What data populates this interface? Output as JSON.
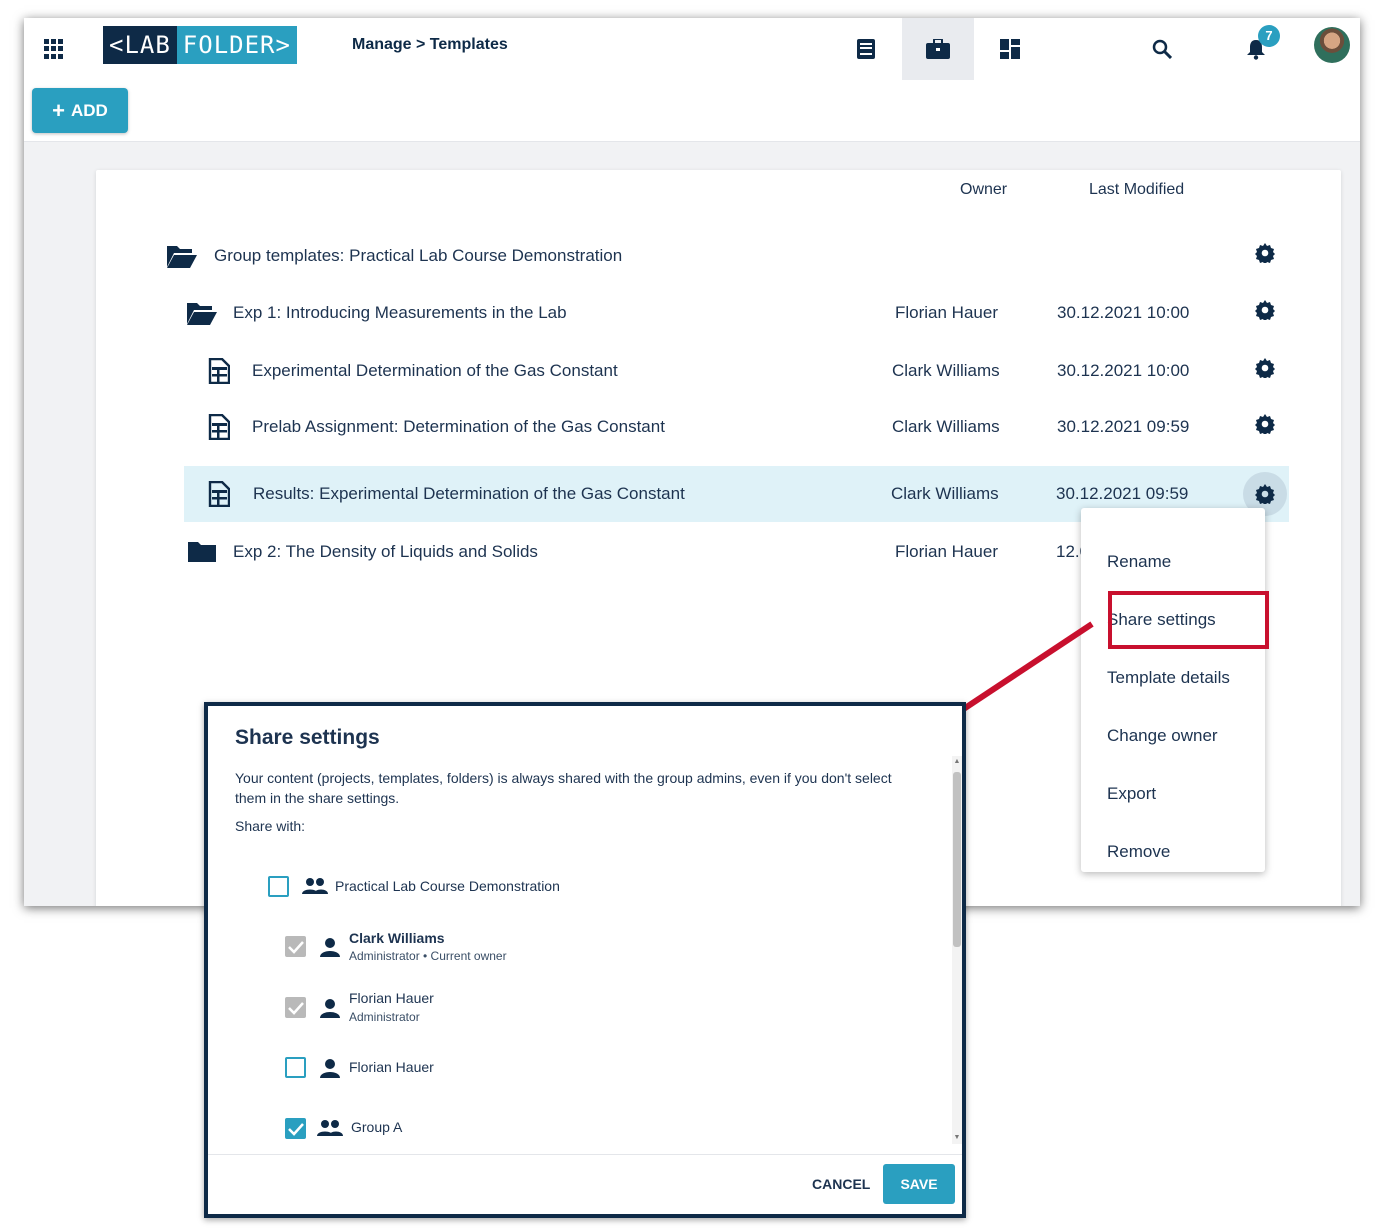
{
  "colors": {
    "navy": "#0e2a47",
    "accent": "#2a9fc0",
    "selected_row": "#dff2f8",
    "highlight": "#c8102e"
  },
  "header": {
    "logo_left": "<LAB",
    "logo_right": "FOLDER>",
    "breadcrumb": "Manage > Templates",
    "notification_count": "7",
    "icons": [
      "apps-grid-icon",
      "notebook-icon",
      "briefcase-icon",
      "dashboard-icon",
      "search-icon",
      "bell-icon"
    ]
  },
  "toolbar": {
    "add_label": "ADD"
  },
  "table": {
    "owner_header": "Owner",
    "modified_header": "Last Modified",
    "rows": [
      {
        "name": "Group templates: Practical Lab Course Demonstration",
        "owner": "",
        "modified": "",
        "icon": "folder-open-icon"
      },
      {
        "name": "Exp 1: Introducing Measurements in the Lab",
        "owner": "Florian Hauer",
        "modified": "30.12.2021 10:00",
        "icon": "folder-open-icon"
      },
      {
        "name": "Experimental Determination of the Gas Constant",
        "owner": "Clark Williams",
        "modified": "30.12.2021 10:00",
        "icon": "template-icon"
      },
      {
        "name": "Prelab Assignment: Determination of the Gas Constant",
        "owner": "Clark Williams",
        "modified": "30.12.2021 09:59",
        "icon": "template-icon"
      },
      {
        "name": "Results: Experimental Determination of the Gas Constant",
        "owner": "Clark Williams",
        "modified": "30.12.2021 09:59",
        "icon": "template-icon"
      },
      {
        "name": "Exp 2: The Density of Liquids and Solids",
        "owner": "Florian Hauer",
        "modified": "12.06.",
        "icon": "folder-icon"
      }
    ]
  },
  "context_menu": {
    "items": [
      "Rename",
      "Share settings",
      "Template details",
      "Change owner",
      "Export",
      "Remove"
    ],
    "highlighted": "Share settings"
  },
  "dialog": {
    "title": "Share settings",
    "description": "Your content (projects, templates, folders) is always shared with the group admins, even if you don't select them in the share settings.",
    "share_with": "Share with:",
    "entries": [
      {
        "name": "Practical Lab Course Demonstration",
        "sub": "",
        "checked": false,
        "type": "group"
      },
      {
        "name": "Clark Williams",
        "sub": "Administrator • Current owner",
        "checked": true,
        "type": "user"
      },
      {
        "name": "Florian Hauer",
        "sub": "Administrator",
        "checked": true,
        "type": "user"
      },
      {
        "name": "Florian Hauer",
        "sub": "",
        "checked": false,
        "type": "user"
      },
      {
        "name": "Group A",
        "sub": "",
        "checked": true,
        "type": "group"
      }
    ],
    "cancel_label": "CANCEL",
    "save_label": "SAVE"
  }
}
